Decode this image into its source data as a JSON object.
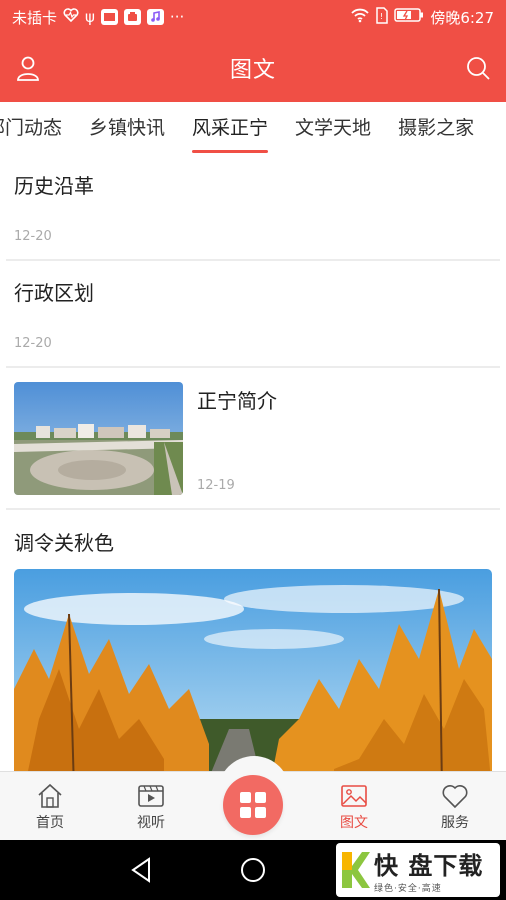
{
  "status_bar": {
    "carrier": "未插卡",
    "usb_symbol": "ψ",
    "more": "···",
    "time": "傍晚6:27",
    "icons": [
      "heart-rate-icon",
      "usb-icon",
      "app-badge-icon",
      "app-badge-2-icon",
      "music-icon",
      "wifi-icon",
      "sim-icon",
      "battery-icon"
    ]
  },
  "header": {
    "title": "图文",
    "left_icon": "user-icon",
    "right_icon": "search-icon"
  },
  "tabs": {
    "items": [
      {
        "label": "部门动态",
        "active": false
      },
      {
        "label": "乡镇快讯",
        "active": false
      },
      {
        "label": "风采正宁",
        "active": true
      },
      {
        "label": "文学天地",
        "active": false
      },
      {
        "label": "摄影之家",
        "active": false
      }
    ]
  },
  "articles": [
    {
      "title": "历史沿革",
      "date": "12-20"
    },
    {
      "title": "行政区划",
      "date": "12-20"
    },
    {
      "title": "正宁简介",
      "date": "12-19"
    },
    {
      "title": "调令关秋色"
    }
  ],
  "bottom_nav": {
    "items": [
      {
        "label": "首页",
        "icon": "home-icon",
        "active": false
      },
      {
        "label": "视听",
        "icon": "video-icon",
        "active": false
      },
      {
        "label": "图文",
        "icon": "image-icon",
        "active": true
      },
      {
        "label": "服务",
        "icon": "heart-icon",
        "active": false
      }
    ],
    "center_icon": "grid-icon"
  },
  "watermark": {
    "brand": "快 盘下载",
    "tagline": "绿色·安全·高速"
  },
  "colors": {
    "brand_red": "#f04f45",
    "center_button": "#f26a63",
    "active_tab": "#e84c43"
  }
}
